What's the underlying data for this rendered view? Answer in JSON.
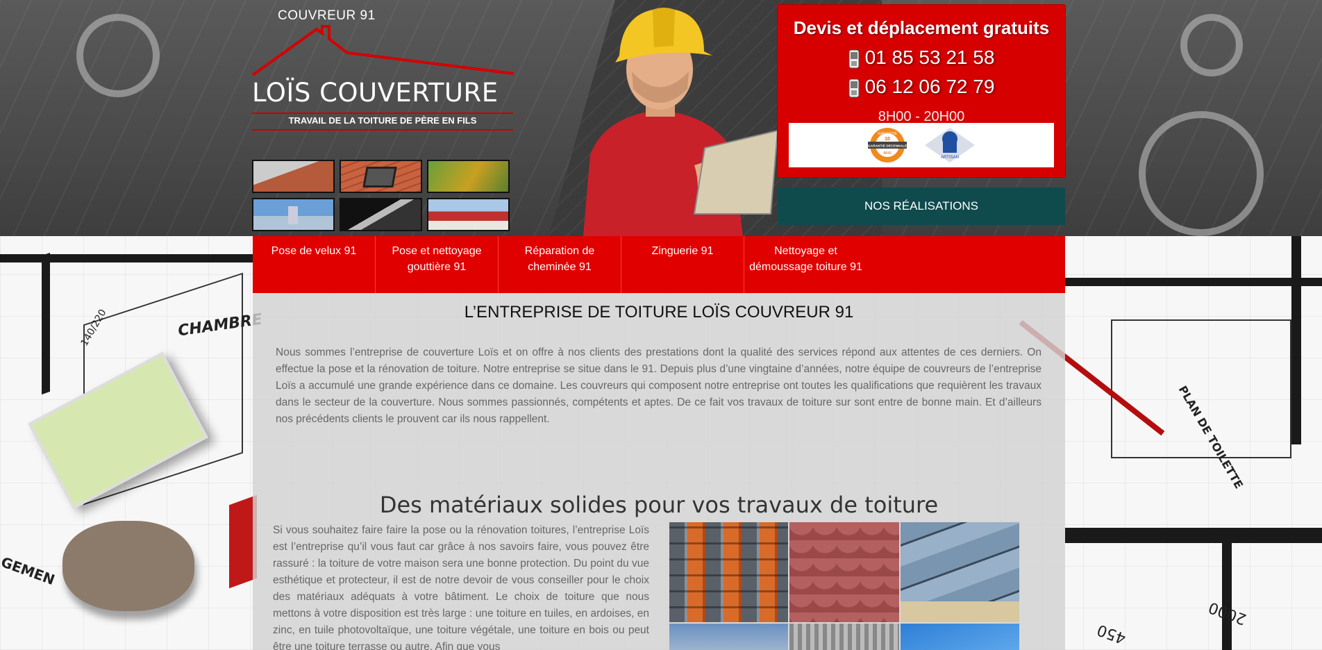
{
  "logo": {
    "top_text": "COUVREUR 91",
    "name": "LOÏS COUVERTURE",
    "tagline": "TRAVAIL DE LA TOITURE DE PÈRE EN FILS"
  },
  "contact": {
    "title": "Devis et déplacement gratuits",
    "phone_1": "01 85 53 21 58",
    "phone_2": "06 12 06 72 79",
    "hours": "8H00 - 20H00",
    "badge_1": "GARANTIE DECENNALE",
    "badge_1_top": "GARANTIE",
    "badge_1_num": "10",
    "badge_1_unit": "ANS",
    "badge_2": "ARTISAN"
  },
  "realisations_button": "NOS RÉALISATIONS",
  "nav": {
    "items": [
      {
        "label": "Pose de velux 91"
      },
      {
        "label": "Pose et nettoyage\ngouttière 91"
      },
      {
        "label": "Réparation de\ncheminée 91"
      },
      {
        "label": "Zinguerie 91"
      },
      {
        "label": "Nettoyage et\ndémoussage toiture 91"
      }
    ]
  },
  "main": {
    "heading": "L’ENTREPRISE DE TOITURE LOÏS COUVREUR 91",
    "intro": "Nous sommes l’entreprise de couverture Loïs et on offre à nos clients des prestations dont la qualité des services répond aux attentes de ces derniers. On effectue la pose et la rénovation de toiture. Notre entreprise se situe dans le 91. Depuis plus d’une vingtaine d’années, notre équipe de couvreurs de l’entreprise Loïs a accumulé une grande expérience dans ce domaine. Les couvreurs qui composent notre entreprise ont toutes les qualifications que requièrent les travaux dans le secteur de la couverture. Nous sommes passionnés, compétents et aptes. De ce fait vos travaux de toiture sur sont entre de bonne main. Et d’ailleurs nos précédents clients le prouvent car ils nous rappellent.",
    "materials_heading": "Des matériaux solides pour vos travaux de toiture",
    "materials_text": "Si vous souhaitez faire faire la pose ou la rénovation toitures, l’entreprise Loïs est l’entreprise qu’il vous faut car grâce à nos savoirs faire, vous pouvez être rassuré : la toiture de votre maison sera une bonne protection. Du point du vue esthétique et protecteur, il est de notre devoir  de vous conseiller pour le choix des matériaux adéquats à votre bâtiment. Le choix de toiture que nous mettons à votre disposition est très large : une toiture en tuiles, en ardoises, en zinc, en tuile photovoltaïque, une toiture végétale, une toiture en bois ou peut être une toiture terrasse ou autre.  Afin que vous"
  },
  "blueprint_labels": {
    "chambre": "CHAMBRE",
    "dims": "140/220",
    "n2000": "2000",
    "n450": "450",
    "plan": "PLAN DE TOILETTE",
    "gement": "GEMEN"
  },
  "colors": {
    "brand_red": "#e10000",
    "contact_red": "#d60000",
    "button_teal": "#0f4a4d"
  }
}
